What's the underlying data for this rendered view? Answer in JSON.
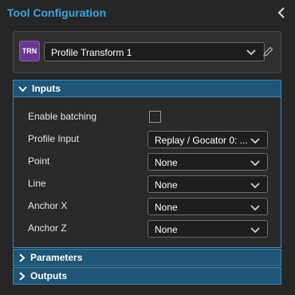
{
  "panel": {
    "title": "Tool Configuration",
    "collapse_icon": "chevron-left-icon"
  },
  "tool": {
    "badge": "TRN",
    "badge_color": "#6c3793",
    "name": "Profile Transform 1"
  },
  "sections": {
    "inputs": "Inputs",
    "parameters": "Parameters",
    "outputs": "Outputs"
  },
  "inputs": {
    "enable_batching": {
      "label": "Enable batching",
      "checked": false
    },
    "profile_input": {
      "label": "Profile Input",
      "value": "Replay / Gocator 0: ..."
    },
    "point": {
      "label": "Point",
      "value": "None"
    },
    "line": {
      "label": "Line",
      "value": "None"
    },
    "anchor_x": {
      "label": "Anchor X",
      "value": "None"
    },
    "anchor_z": {
      "label": "Anchor Z",
      "value": "None"
    }
  },
  "colors": {
    "accent": "#3da4dd",
    "section_header": "#1f5577",
    "section_border": "#3d88b8"
  }
}
